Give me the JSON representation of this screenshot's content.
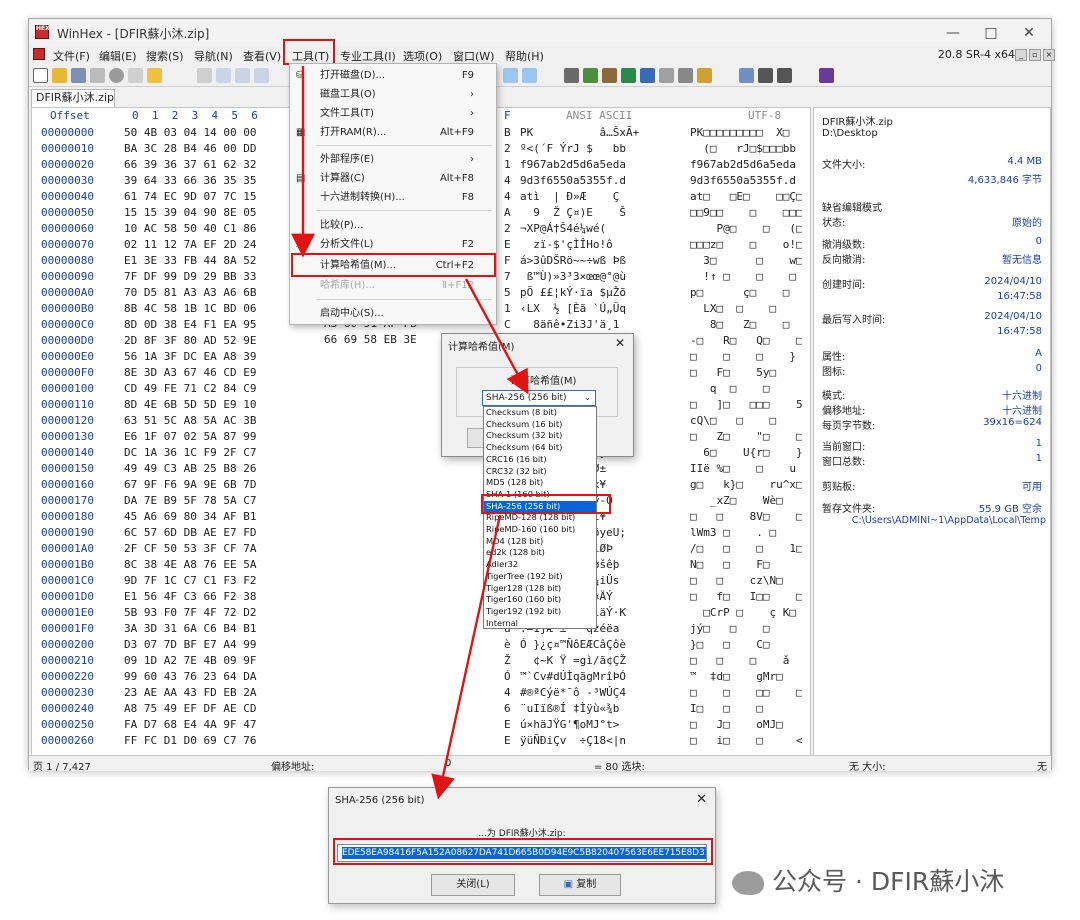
{
  "window": {
    "title": "WinHex - [DFIR蘇小沐.zip]",
    "logo": "HEX",
    "min": "—",
    "max": "□",
    "close": "✕"
  },
  "menubar": {
    "items": [
      "文件(F)",
      "编辑(E)",
      "搜索(S)",
      "导航(N)",
      "查看(V)",
      "工具(T)",
      "专业工具(I)",
      "选项(O)",
      "窗口(W)",
      "帮助(H)"
    ],
    "version": "20.8 SR-4 x64",
    "mdi": [
      "_",
      "▫",
      "×"
    ]
  },
  "tab": {
    "label": "DFIR蘇小沐.zip"
  },
  "hex_header": {
    "offset": "Offset",
    "cols_left": "0  1  2  3  4  5  6",
    "col_right": "F",
    "ansi": "ANSI ASCII",
    "utf8": "UTF-8"
  },
  "rows": [
    {
      "off": "00000000",
      "hx": "50 4B 03 04 14 00 00",
      "r": "B",
      "asc": "PK          â…ŠxÃ+",
      "u8": "PK□□□□□□□□□  X□"
    },
    {
      "off": "00000010",
      "hx": "BA 3C 28 B4 46 00 DD",
      "r": "2",
      "asc": "º<(´F ÝrJ $   bb",
      "u8": "  (□   rJ□$□□□bb"
    },
    {
      "off": "00000020",
      "hx": "66 39 36 37 61 62 32",
      "r": "1",
      "asc": "f967ab2d5d6a5eda",
      "u8": "f967ab2d5d6a5eda"
    },
    {
      "off": "00000030",
      "hx": "39 64 33 66 36 35 35",
      "r": "4",
      "asc": "9d3f6550a5355f.d",
      "u8": "9d3f6550a5355f.d"
    },
    {
      "off": "00000040",
      "hx": "61 74 EC 9D 07 7C 15",
      "r": "4",
      "asc": "atì  | Ð»Æ    Ç",
      "u8": "at□   □E□    □□Ç□"
    },
    {
      "off": "00000050",
      "hx": "15 15 39 04 90 8E 05",
      "r": "A",
      "asc": "  9  Ž Ç¤)E    Š",
      "u8": "□□9□□    □    □□□□"
    },
    {
      "off": "00000060",
      "hx": "10 AC 58 50 40 C1 86",
      "r": "2",
      "asc": "¬XP@Á†Š4é¼wé(",
      "u8": "    P@□    □   (□□"
    },
    {
      "off": "00000070",
      "hx": "02 11 12 7A EF 2D 24",
      "r": "E",
      "asc": "  zï-$'çÌÎHo!ô",
      "u8": "□□□z□    □    o!□"
    },
    {
      "off": "00000080",
      "hx": "E1 3E 33 FB 44 8A 52",
      "r": "F",
      "asc": "á>3ûDŠRö~~÷wß Þß",
      "u8": "  3□      □    w□"
    },
    {
      "off": "00000090",
      "hx": "7F DF 99 D9 29 BB 33",
      "r": "7",
      "asc": " ß™Ù)»3³3×œœ@°@ù",
      "u8": "  !↑ □    □    □"
    },
    {
      "off": "000000A0",
      "hx": "70 D5 81 A3 A3 A6 6B",
      "r": "5",
      "asc": "pÕ ££¦kÝ·ïa $µŽõ",
      "u8": "p□      ç□    □"
    },
    {
      "off": "000000B0",
      "hx": "8B 4C 58 1B 1C BD 06",
      "r": "1",
      "asc": "‹LX  ½ [Èã `Ú„Üq",
      "u8": "  LX□  □    □"
    },
    {
      "off": "000000C0",
      "hx": "8D 0D 38 E4 F1 EA 95",
      "r": "C",
      "asc": "  8äñê•Zi3J'ä¸1",
      "u8": "   8□   Z□    □"
    },
    {
      "off": "000000D0",
      "hx": "2D 8F 3F 80 AD 52 9E",
      "r": "A",
      "asc": "-□?€­Rž  ·Q   ÷Â",
      "u8": "-□   R□   Q□    □"
    },
    {
      "off": "000000E0",
      "hx": "56 1A 3F DC EA A8 39",
      "r": "}",
      "asc": "V ?Üê¨9  }   }",
      "u8": "□    □    □    }"
    },
    {
      "off": "000000F0",
      "hx": "8E 3D A3 67 46 CD E9",
      "r": "Ç",
      "asc": "Ž=£gFÍé   Ç",
      "u8": "□   F□    5y□    □"
    },
    {
      "off": "00000100",
      "hx": "CD 49 FE 71 C2 84 C9",
      "r": "Q",
      "asc": "ÍIþqÂ„É      Q",
      "u8": "   q  □    □     Q_"
    },
    {
      "off": "00000110",
      "hx": "8D 4E 6B 5D 5D E9 10",
      "r": "5",
      "asc": "Nk]]é   5",
      "u8": "□   ]□   □□□    5"
    },
    {
      "off": "00000120",
      "hx": "63 51 5C A8 5A AC 3B",
      "r": "i",
      "asc": "cQ\\¨Z¬;     i",
      "u8": "cQ\\□   □    □"
    },
    {
      "off": "00000130",
      "hx": "E6 1F 07 02 5A 87 99",
      "r": "ñ",
      "asc": "æ    Z‡™     ñ",
      "u8": "□   Z□    \"□    □"
    },
    {
      "off": "00000140",
      "hx": "DC 1A 36 1C F9 2F C7",
      "r": "}",
      "asc": "Ü 6 ù/Ç     }",
      "u8": "  6□    U{r□    }"
    },
    {
      "off": "00000150",
      "hx": "49 49 C3 AB 25 B8 26",
      "r": "±",
      "asc": "IIÃ«%¸&çæüuØ±",
      "u8": "IIë %□    □    u"
    },
    {
      "off": "00000160",
      "hx": "67 9F F6 9A 9E 6B 7D",
      "r": "D",
      "asc": "gŸöšžk}Ðru^x¥",
      "u8": "g□   k}□    ru^x□"
    },
    {
      "off": "00000170",
      "hx": "DA 7E B9 5F 78 5A C7",
      "r": "O",
      "asc": "Ú~¹_xZÇ  ñ¨ÿ-O",
      "u8": "   _xZ□    Wè□"
    },
    {
      "off": "00000180",
      "hx": "45 A6 69 80 34 AF B1",
      "r": "¥",
      "asc": "E¦i€4¯±   ÿÍ¥",
      "u8": "□   □    8V□    □"
    },
    {
      "off": "00000190",
      "hx": "6C 57 6D DB AE E7 FD",
      "r": "U",
      "asc": "lWmÛ®çý   ·ðyeU;",
      "u8": "lWm3 □    . □     ;"
    },
    {
      "off": "000001A0",
      "hx": "2F CF 50 53 3F CF 7A",
      "r": "Þ",
      "asc": "/ÏPS?Ïz  ¹plØÞ",
      "u8": "/□   □    □    1□"
    },
    {
      "off": "000001B0",
      "hx": "8C 38 4E A8 76 EE 5A",
      "r": "p",
      "asc": "Œ8N¨vîZ  ¤Føšêþ",
      "u8": "N□   □    F□"
    },
    {
      "off": "000001C0",
      "hx": "9D 7F 1C C7 C1 F3 F2",
      "r": "s",
      "asc": "  ÇÁóò   \\N¼iÜs",
      "u8": "□   □    cz\\N□"
    },
    {
      "off": "000001D0",
      "hx": "E1 56 4F C3 66 F2 38",
      "r": "Ý",
      "asc": "áVOÃfò8  ýÄ¤ÄÝ",
      "u8": "□   f□   I□□    □"
    },
    {
      "off": "000001E0",
      "hx": "5B 93 F0 7F 4F 72 D2",
      "r": "K",
      "asc": "[“ð Or Ò  öläÝ·K",
      "u8": "  □CrP □    ç K□"
    },
    {
      "off": "000001F0",
      "hx": "3A 3D 31 6A C6 B4 B1",
      "r": "a",
      "asc": ":=1jÆ´±  ¯qzéëa",
      "u8": "jý□   □    □"
    },
    {
      "off": "00000200",
      "hx": "D3 07 7D BF E7 A4 99",
      "r": "è",
      "asc": "Ó }¿ç¤™ÑôEÆCâÇôè",
      "u8": "}□   □    C□"
    },
    {
      "off": "00000210",
      "hx": "09 1D A2 7E 4B 09 9F",
      "r": "Ž",
      "asc": "  ¢~K Ÿ =gì/ã¢ÇŽ",
      "u8": "□   □    □    ǎ"
    },
    {
      "off": "00000220",
      "hx": "99 60 43 76 23 64 DA",
      "r": "Ó",
      "asc": "™`Cv#dÚÌqãgMrîÞÓ",
      "u8": "™  ‡d□    gMr□"
    },
    {
      "off": "00000230",
      "hx": "23 AE AA 43 FD EB 2A",
      "r": "4",
      "asc": "#®ªCýë*¯ô -³WÚÇ4",
      "u8": "□    □    □□    □"
    },
    {
      "off": "00000240",
      "hx": "A8 75 49 EF DF AE CD",
      "r": "6",
      "asc": "¨uIïß®Í ‡Ìÿù«¾b",
      "u8": "I□   □    □"
    },
    {
      "off": "00000250",
      "hx": "FA D7 68 E4 4A 9F 47",
      "r": "E",
      "asc": "ú×häJŸG'¶oMJ°t>",
      "u8": "□   J□    oMJ□"
    },
    {
      "off": "00000260",
      "hx": "FF FC D1 D0 69 C7 76",
      "r": "E",
      "asc": "ÿüÑÐiÇv  ÷Ç18<|n",
      "u8": "□   i□    □     <|n"
    }
  ],
  "hex_middle": {
    "line1": "A3 60 51 AF FB",
    "line2": "66 69 58 EB 3E"
  },
  "info": {
    "filename": "DFIR蘇小沐.zip",
    "path": "D:\\Desktop",
    "size_label": "文件大小:",
    "size_mb": "4.4 MB",
    "size_bytes": "4,633,846 字节",
    "mode_label": "缺省编辑模式",
    "state_label": "状态:",
    "state_val": "原始的",
    "undo_label": "撤消级数:",
    "undo_val": "0",
    "rev_label": "反向撤消:",
    "rev_val": "暂无信息",
    "created_label": "创建时间:",
    "created_date": "2024/04/10",
    "created_time": "16:47:58",
    "written_label": "最后写入时间:",
    "written_date": "2024/04/10",
    "written_time": "16:47:58",
    "attr_label": "属性:",
    "attr_val": "A",
    "icon_label": "图标:",
    "icon_val": "0",
    "mode2_label": "模式:",
    "mode2_val": "十六进制",
    "offs_label": "偏移地址:",
    "offs_val": "十六进制",
    "bpp_label": "每页字节数:",
    "bpp_val": "39x16=624",
    "curwin_label": "当前窗口:",
    "curwin_val": "1",
    "totwin_label": "窗口总数:",
    "totwin_val": "1",
    "clip_label": "剪贴板:",
    "clip_val": "可用",
    "temp_label": "暂存文件夹:",
    "temp_val": "55.9 GB 空余",
    "temp_path": "C:\\Users\\ADMINI~1\\AppData\\Local\\Temp"
  },
  "status": {
    "page": "页 1 / 7,427",
    "offset_label": "偏移地址:",
    "offset_val": "0",
    "sel": "= 80  选块:",
    "size": "无  大小:",
    "right": "无"
  },
  "tools_menu": {
    "items": [
      {
        "label": "打开磁盘(D)...",
        "key": "F9"
      },
      {
        "label": "磁盘工具(O)",
        "key": "›"
      },
      {
        "label": "文件工具(T)",
        "key": "›"
      },
      {
        "label": "打开RAM(R)...",
        "key": "Alt+F9"
      },
      {
        "label": "外部程序(E)",
        "key": "›"
      },
      {
        "label": "计算器(C)",
        "key": "Alt+F8"
      },
      {
        "label": "十六进制转换(H)...",
        "key": "F8"
      },
      {
        "label": "比较(P)...",
        "key": ""
      },
      {
        "label": "分析文件(L)",
        "key": "F2"
      },
      {
        "label": "计算哈希值(M)...",
        "key": "Ctrl+F2"
      },
      {
        "label": "哈希库(H)...",
        "key": "Ⅱ+F12"
      },
      {
        "label": "启动中心(S)...",
        "key": ""
      }
    ]
  },
  "hash_dialog": {
    "title": "计算哈希值(M)",
    "close": "✕",
    "group": "计算哈希值(M)",
    "selected": "SHA-256 (256 bit)",
    "options": [
      "Checksum (8 bit)",
      "Checksum (16 bit)",
      "Checksum (32 bit)",
      "Checksum (64 bit)",
      "CRC16 (16 bit)",
      "CRC32 (32 bit)",
      "MD5 (128 bit)",
      "SHA-1 (160 bit)",
      "SHA-256 (256 bit)",
      "RipeMD-128 (128 bit)",
      "RipeMD-160 (160 bit)",
      "MD4 (128 bit)",
      "ed2k (128 bit)",
      "Adler32",
      "TigerTree (192 bit)",
      "Tiger128 (128 bit)",
      "Tiger160 (160 bit)",
      "Tiger192 (192 bit)",
      "Internal"
    ],
    "selected_index": 8
  },
  "result_dialog": {
    "title": "SHA-256 (256 bit)",
    "close": "✕",
    "for_label": "...为 DFIR蘇小沐.zip:",
    "hash": "EDE58EA98416F5A152A08627DA741D665B0D94E9C5B820407563E6EE715E8D31",
    "close_btn": "关闭(L)",
    "copy_btn": "复制"
  },
  "watermark": {
    "text": "公众号 · DFIR蘇小沐"
  },
  "colors": {
    "accent_red": "#e01414",
    "select_blue": "#0a64d8",
    "offset_blue": "#1a3fa8"
  }
}
